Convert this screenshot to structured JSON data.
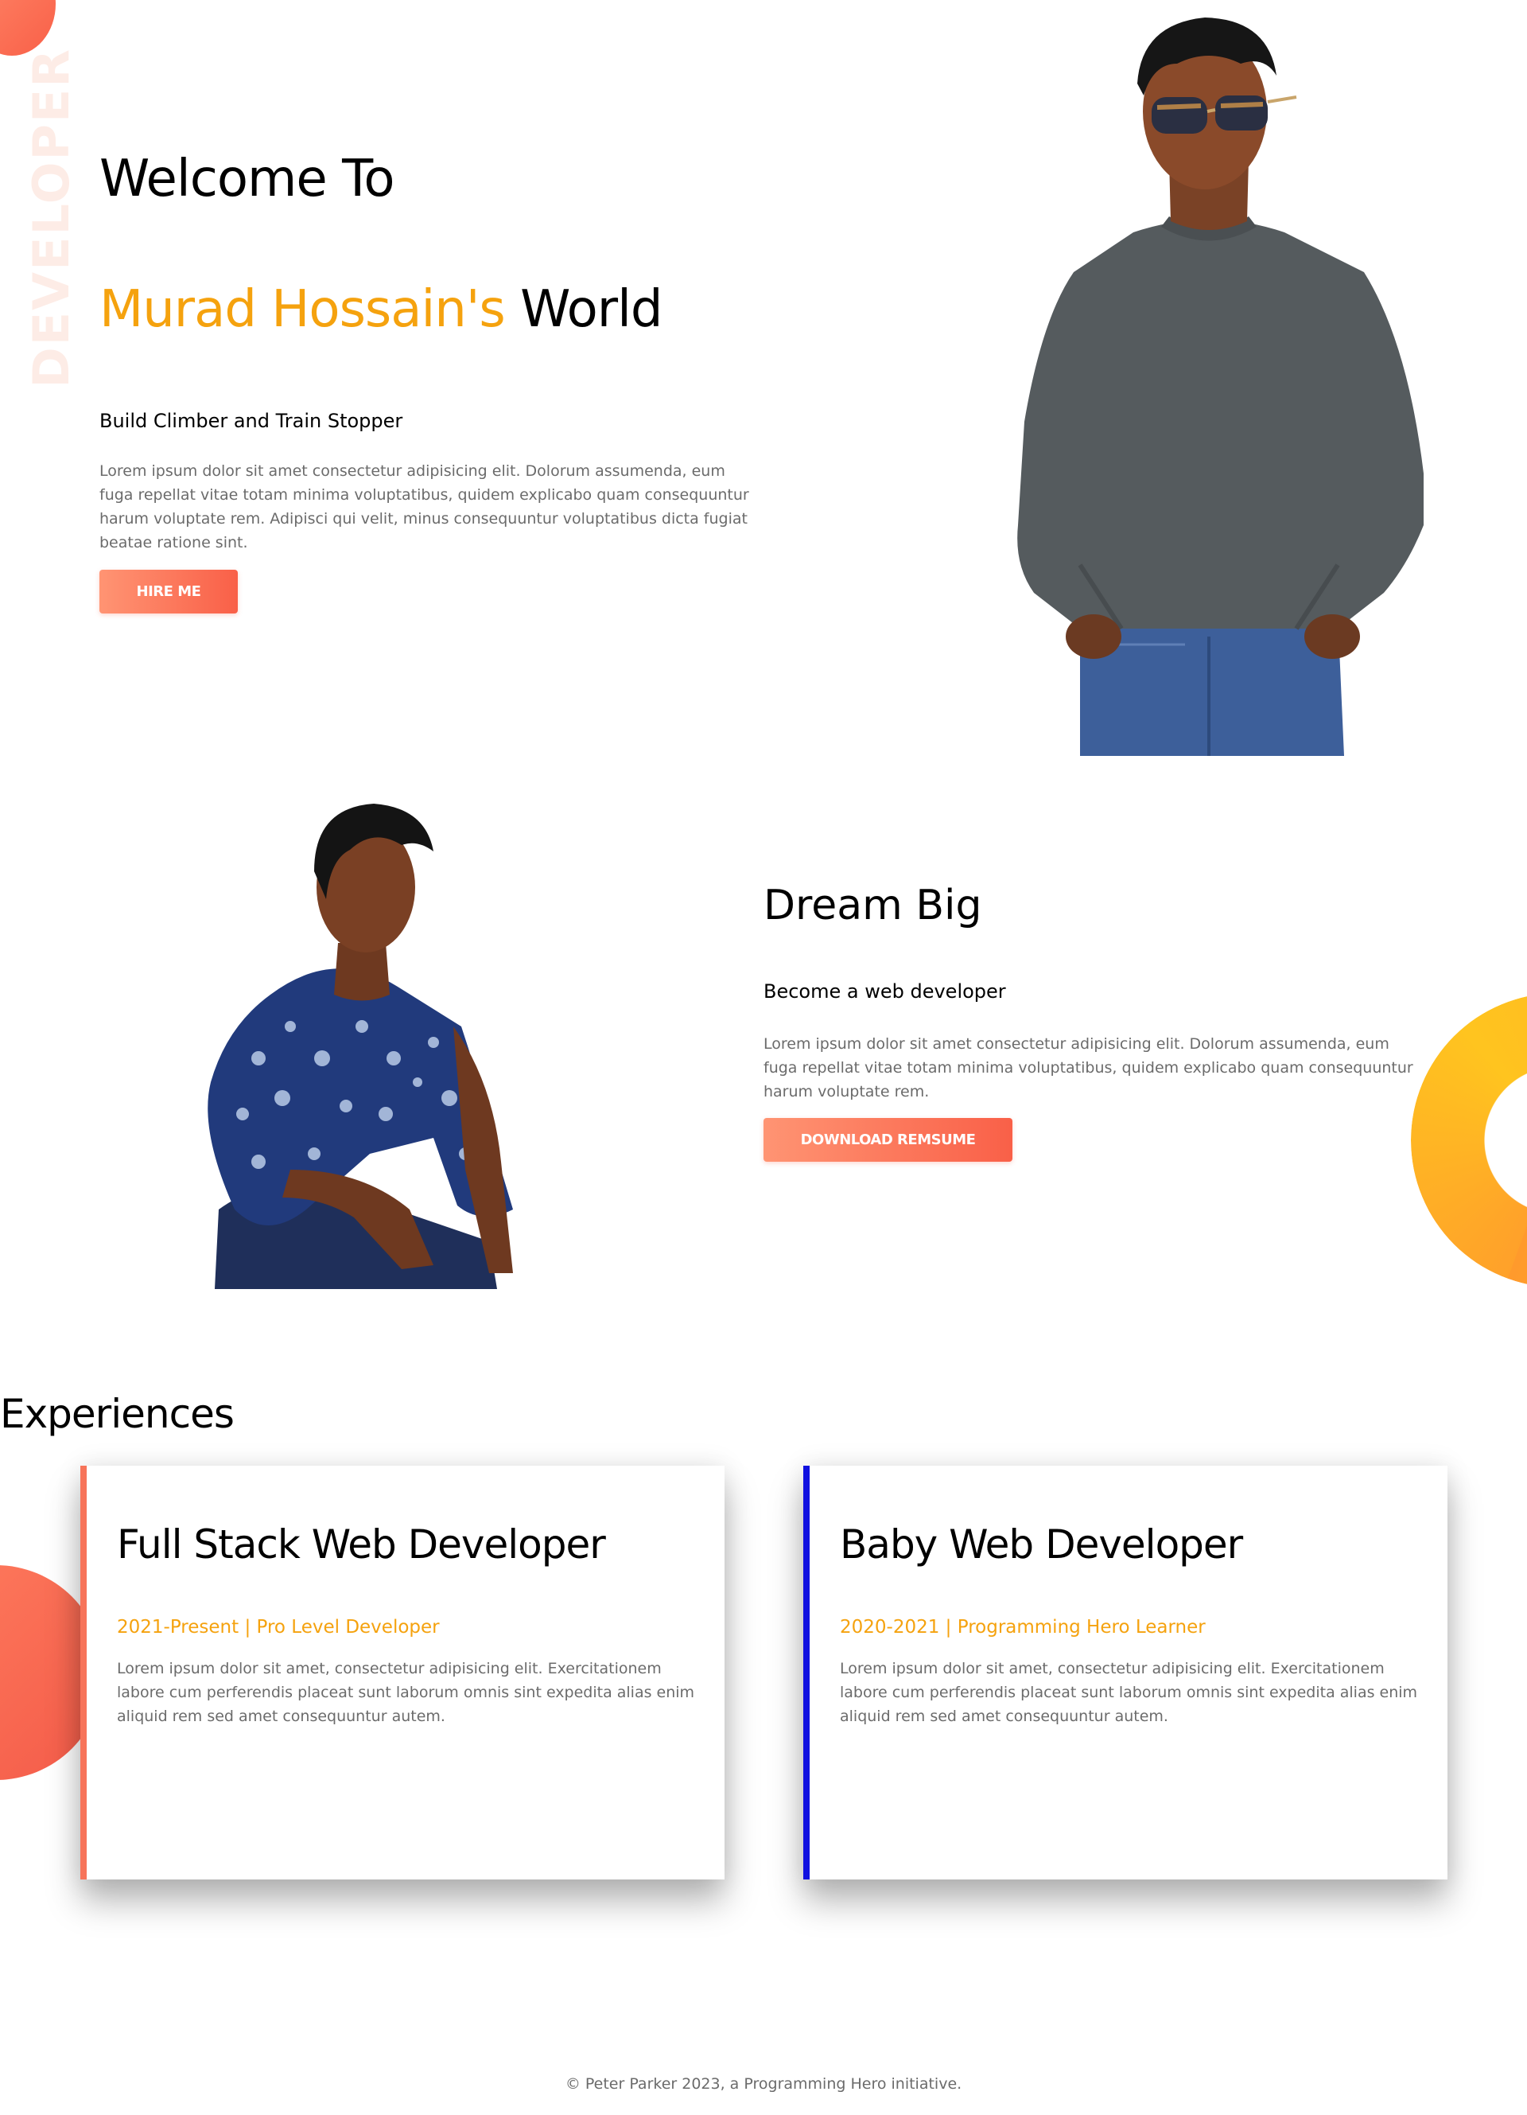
{
  "decor": {
    "vertical_word": "DEVELOPER"
  },
  "hero": {
    "welcome": "Welcome To",
    "name_highlight": "Murad Hossain's",
    "world": "World",
    "subtitle": "Build Climber and Train Stopper",
    "paragraph": "Lorem ipsum dolor sit amet consectetur adipisicing elit. Dolorum assumenda, eum fuga repellat vitae totam minima voluptatibus, quidem explicabo quam consequuntur harum voluptate rem. Adipisci qui velit, minus consequuntur voluptatibus dicta fugiat beatae ratione sint.",
    "hire_button": "HIRE ME"
  },
  "about": {
    "title": "Dream Big",
    "subtitle": "Become a web developer",
    "paragraph": "Lorem ipsum dolor sit amet consectetur adipisicing elit. Dolorum assumenda, eum fuga repellat vitae totam minima voluptatibus, quidem explicabo quam consequuntur harum voluptate rem.",
    "download_button": "DOWNLOAD REMSUME"
  },
  "experiences": {
    "title": "Experiences",
    "cards": [
      {
        "title": "Full Stack Web Developer",
        "meta": "2021-Present | Pro Level Developer",
        "text": "Lorem ipsum dolor sit amet, consectetur adipisicing elit. Exercitationem labore cum perferendis placeat sunt laborum omnis sint expedita alias enim aliquid rem sed amet consequuntur autem."
      },
      {
        "title": "Baby Web Developer",
        "meta": "2020-2021 | Programming Hero Learner",
        "text": "Lorem ipsum dolor sit amet, consectetur adipisicing elit. Exercitationem labore cum perferendis placeat sunt laborum omnis sint expedita alias enim aliquid rem sed amet consequuntur autem."
      }
    ]
  },
  "footer": {
    "text": "© Peter Parker 2023, a Programming Hero initiative."
  },
  "colors": {
    "accent_orange": "#f5a20e",
    "button_gradient_start": "#ff9473",
    "button_gradient_end": "#f96048",
    "card_border_red": "#f7745a",
    "card_border_blue": "#1010e0"
  }
}
